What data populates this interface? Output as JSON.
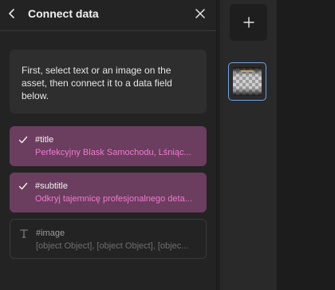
{
  "panel": {
    "title": "Connect data",
    "back_icon": "chevron-left-icon",
    "close_icon": "close-icon",
    "info_text": "First, select text or an image on the asset, then connect it to a data field below."
  },
  "fields": [
    {
      "name": "#title",
      "value": "Perfekcyjny Blask Samochodu, Lśniąc...",
      "status": "connected",
      "icon": "check-icon"
    },
    {
      "name": "#subtitle",
      "value": "Odkryj tajemnicę profesjonalnego deta...",
      "status": "connected",
      "icon": "check-icon"
    },
    {
      "name": "#image",
      "value": "[object Object], [object Object], [objec...",
      "status": "not-connected",
      "icon": "text-type-icon"
    }
  ],
  "rail": {
    "add_icon": "plus-icon",
    "thumbnail_icon": "page-thumbnail"
  },
  "colors": {
    "accent_field": "#6b3d5e",
    "value_pink": "#f07ad0",
    "thumb_border": "#6da3e6"
  }
}
